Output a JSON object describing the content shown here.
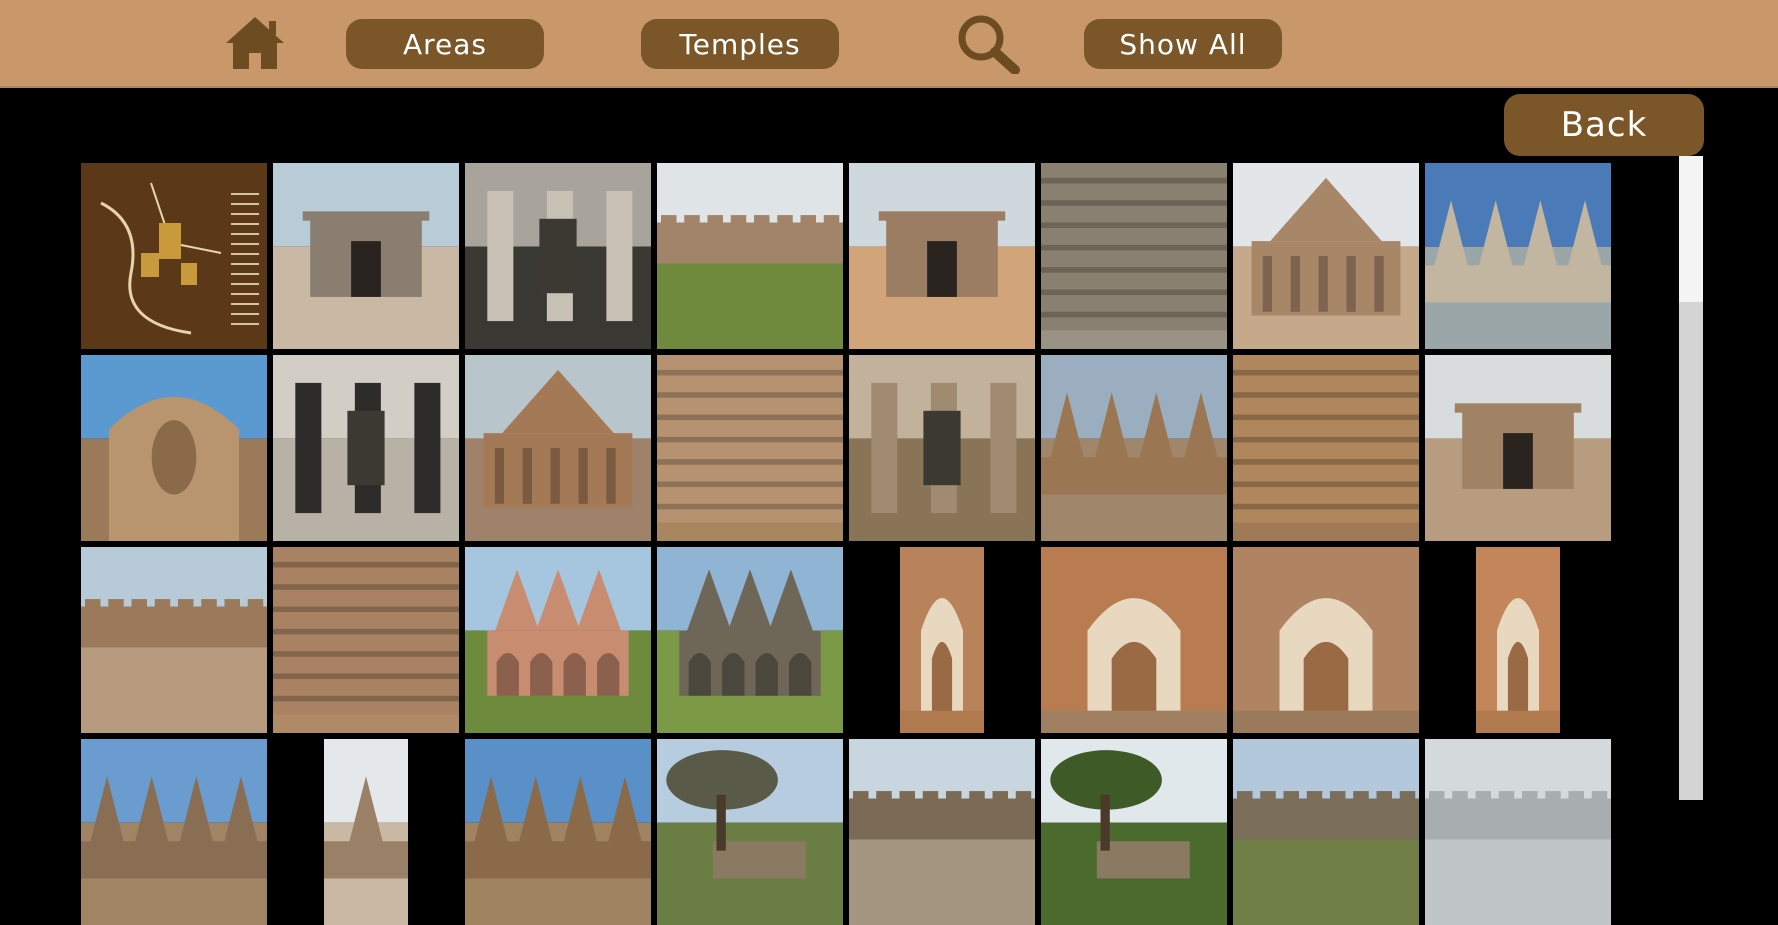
{
  "nav": {
    "home_icon": "home-icon",
    "areas_label": "Areas",
    "temples_label": "Temples",
    "search_icon": "search-icon",
    "show_all_label": "Show All"
  },
  "back_label": "Back",
  "colors": {
    "topbar": "#c8986a",
    "button": "#7a5628",
    "icon": "#6e4c22",
    "background": "#000000"
  },
  "gallery": {
    "rows": [
      [
        {
          "name": "site-map",
          "sky": "#5a3818",
          "ground": "#8a5a2c",
          "stone": "#c99a3c",
          "kind": "map"
        },
        {
          "name": "stepped-tank-gateway",
          "sky": "#b8ccd8",
          "ground": "#c9b9a4",
          "stone": "#8a7e70",
          "kind": "gate"
        },
        {
          "name": "pillared-water-hall",
          "sky": "#a8a49c",
          "ground": "#3a3832",
          "stone": "#c8c2b6",
          "kind": "hall"
        },
        {
          "name": "long-enclosure-wall",
          "sky": "#dfe4e6",
          "ground": "#6f8a3c",
          "stone": "#a2846a",
          "kind": "wall"
        },
        {
          "name": "mandapa-gateway",
          "sky": "#cfd8dc",
          "ground": "#d2a47a",
          "stone": "#9a7d62",
          "kind": "gate"
        },
        {
          "name": "carved-frieze-wall",
          "sky": "#b8b2a4",
          "ground": "#9a9284",
          "stone": "#8a8070",
          "kind": "frieze"
        },
        {
          "name": "pavilion-tower",
          "sky": "#e2e6e8",
          "ground": "#c6a88a",
          "stone": "#a88668",
          "kind": "tower"
        },
        {
          "name": "shrine-towers-sky",
          "sky": "#4a7ab8",
          "ground": "#9aa6a8",
          "stone": "#c2b6a0",
          "kind": "towers"
        }
      ],
      [
        {
          "name": "carved-deity-niche",
          "sky": "#5a9ad0",
          "ground": "#9a7a58",
          "stone": "#b8956e",
          "kind": "niche"
        },
        {
          "name": "black-pillar-hall",
          "sky": "#d2cec6",
          "ground": "#b8b2a6",
          "stone": "#2e2c2a",
          "kind": "hall"
        },
        {
          "name": "temple-exterior-side",
          "sky": "#b8c6cc",
          "ground": "#a0826a",
          "stone": "#a47a56",
          "kind": "tower"
        },
        {
          "name": "carved-wall-panel",
          "sky": "#b69a78",
          "ground": "#a88660",
          "stone": "#b79270",
          "kind": "frieze"
        },
        {
          "name": "stone-pillar-corridor",
          "sky": "#c2b29c",
          "ground": "#8a7458",
          "stone": "#a08a70",
          "kind": "hall"
        },
        {
          "name": "temple-complex-view",
          "sky": "#9aaec0",
          "ground": "#a0866a",
          "stone": "#9a7652",
          "kind": "towers"
        },
        {
          "name": "carved-temple-wall",
          "sky": "#c6ad8c",
          "ground": "#a07a56",
          "stone": "#b0865c",
          "kind": "frieze"
        },
        {
          "name": "temple-doorway",
          "sky": "#d8dcdc",
          "ground": "#b89c80",
          "stone": "#a08264",
          "kind": "gate"
        }
      ],
      [
        {
          "name": "colonnade-wall",
          "sky": "#b6cad8",
          "ground": "#b89a7e",
          "stone": "#9a7a5a",
          "kind": "wall"
        },
        {
          "name": "relief-wall-courtyard",
          "sky": "#b8c8d4",
          "ground": "#b08a66",
          "stone": "#a88262",
          "kind": "frieze"
        },
        {
          "name": "lotus-mahal-pink",
          "sky": "#a6c6e0",
          "ground": "#6e8a3c",
          "stone": "#c88c70",
          "kind": "palace"
        },
        {
          "name": "lotus-mahal-garden",
          "sky": "#8fb4d4",
          "ground": "#7c9a46",
          "stone": "#6e6656",
          "kind": "palace"
        },
        {
          "name": "arched-passage-narrow",
          "sky": "#000000",
          "ground": "#b07a4e",
          "stone": "#b8825a",
          "kind": "arch",
          "narrow": true
        },
        {
          "name": "arched-hall-sunlit",
          "sky": "#e8d8c0",
          "ground": "#a08060",
          "stone": "#b87c50",
          "kind": "arch"
        },
        {
          "name": "arched-corridor",
          "sky": "#d0b898",
          "ground": "#9a7a5a",
          "stone": "#b08462",
          "kind": "arch"
        },
        {
          "name": "single-arch-window",
          "sky": "#000000",
          "ground": "#b07a4e",
          "stone": "#c2865a",
          "kind": "arch",
          "narrow": true
        }
      ],
      [
        {
          "name": "tower-blue-sky",
          "sky": "#6a9cd0",
          "ground": "#a08464",
          "stone": "#8a6e54",
          "kind": "towers"
        },
        {
          "name": "small-shrine-narrow",
          "sky": "#e4e8ea",
          "ground": "#c8b8a4",
          "stone": "#9a8066",
          "kind": "towers",
          "narrow": true
        },
        {
          "name": "ruined-temple-sky",
          "sky": "#5a90c8",
          "ground": "#a08462",
          "stone": "#8a6a48",
          "kind": "towers"
        },
        {
          "name": "tree-and-ruins",
          "sky": "#b8cce0",
          "ground": "#6a7e44",
          "stone": "#5a5a48",
          "kind": "tree"
        },
        {
          "name": "stone-pavilion-distance",
          "sky": "#c8d6e0",
          "ground": "#a49680",
          "stone": "#7a6a56",
          "kind": "wall"
        },
        {
          "name": "trees-over-ruins",
          "sky": "#e0e8ec",
          "ground": "#4a6a2e",
          "stone": "#3e5a26",
          "kind": "tree"
        },
        {
          "name": "aqueduct-arches",
          "sky": "#b4c8dc",
          "ground": "#6e7e46",
          "stone": "#7a6e5a",
          "kind": "wall"
        },
        {
          "name": "hazy-landscape",
          "sky": "#d4dadc",
          "ground": "#c0c6c6",
          "stone": "#a8aeb0",
          "kind": "wall"
        }
      ]
    ]
  }
}
